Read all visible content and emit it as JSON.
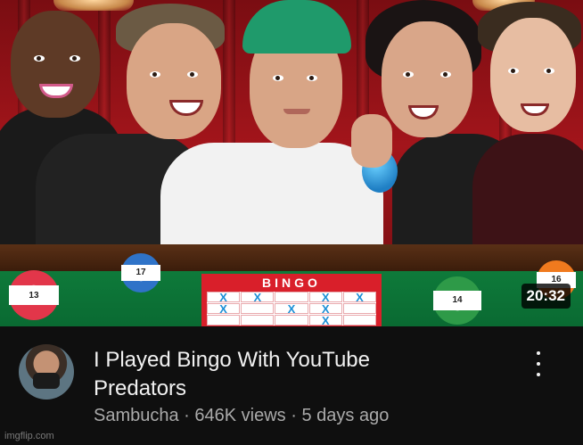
{
  "video": {
    "duration": "20:32",
    "title": "I Played Bingo With YouTube Predators",
    "channel": "Sambucha",
    "views": "646K views",
    "age": "5 days ago",
    "separator": " · "
  },
  "thumbnail": {
    "bingo_title": "BINGO",
    "grid": [
      "X",
      "X",
      "",
      "X",
      "X",
      "X",
      "",
      "X",
      "X",
      "",
      "",
      "",
      "",
      "X",
      ""
    ],
    "balls": [
      "13",
      "13",
      "17",
      "17",
      "14",
      "14",
      "16",
      "16"
    ],
    "colors": {
      "background": "#a3151b",
      "felt": "#0e7a3a",
      "card": "#d91f2a",
      "x_mark": "#1c8fd6"
    }
  },
  "watermark": "imgflip.com",
  "theme": {
    "page_bg": "#0f0f0f",
    "text_primary": "#f1f1f1",
    "text_secondary": "#aaaaaa"
  },
  "icons": {
    "menu": "more-vertical-icon",
    "avatar": "channel-avatar"
  }
}
